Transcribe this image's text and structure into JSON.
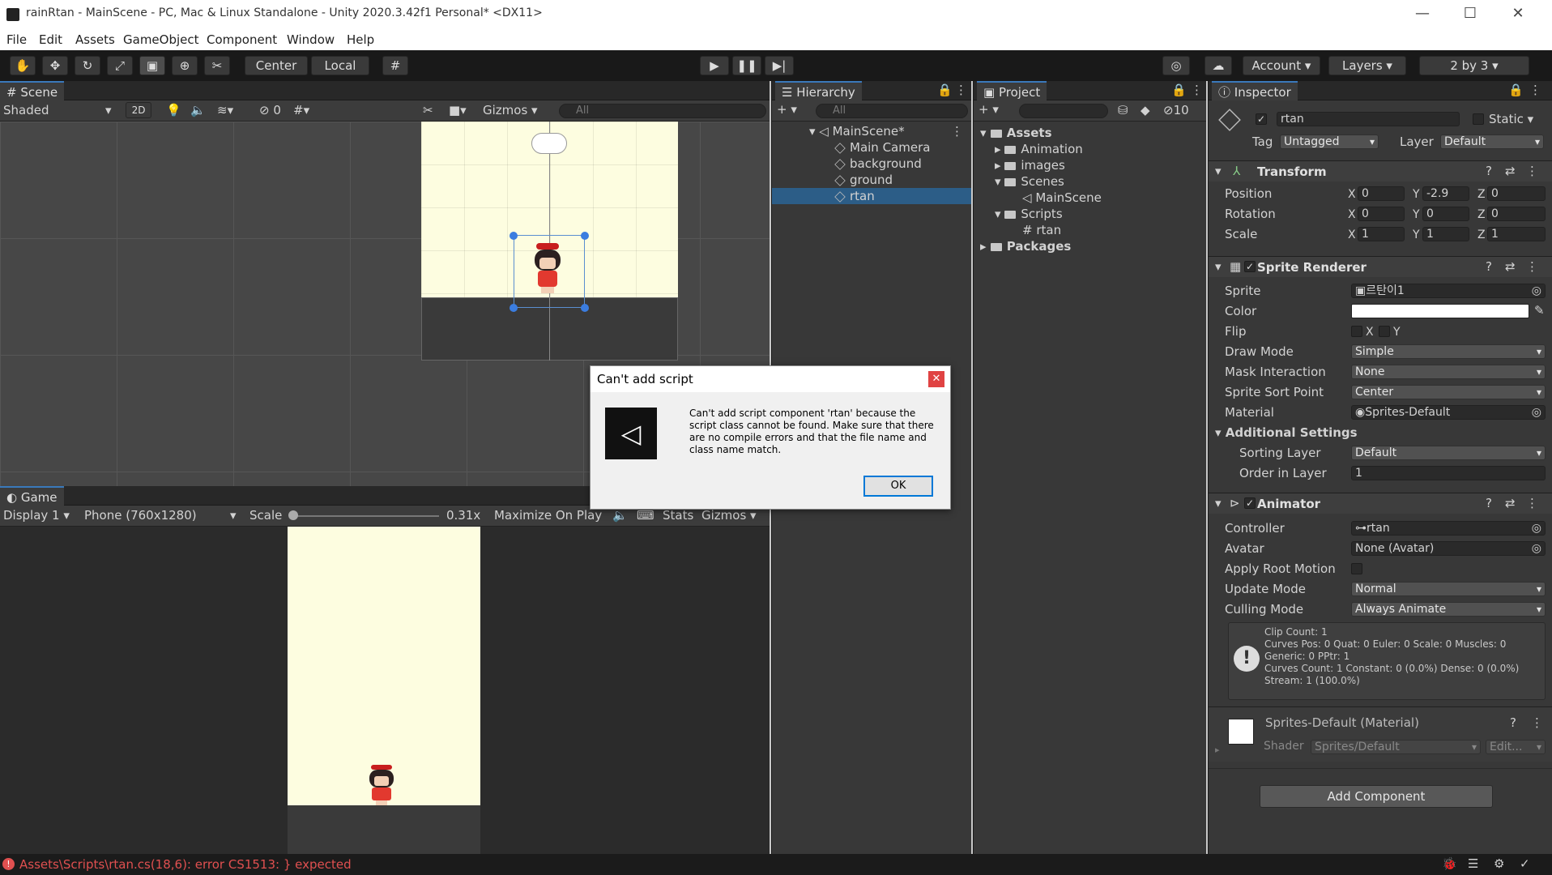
{
  "window": {
    "title": "rainRtan - MainScene - PC, Mac & Linux Standalone - Unity 2020.3.42f1 Personal* <DX11>",
    "minimize": "—",
    "maximize": "☐",
    "close": "✕"
  },
  "menu": [
    "File",
    "Edit",
    "Assets",
    "GameObject",
    "Component",
    "Window",
    "Help"
  ],
  "toolbar": {
    "center": "Center",
    "local": "Local",
    "account": "Account",
    "layers": "Layers",
    "layout": "2 by 3"
  },
  "scene": {
    "tab": "Scene",
    "shading": "Shaded",
    "mode2d": "2D",
    "hidden_count": "0",
    "gizmos": "Gizmos",
    "search": "All"
  },
  "game": {
    "tab": "Game",
    "display": "Display 1",
    "resolution": "Phone (760x1280)",
    "scale_label": "Scale",
    "scale_value": "0.31x",
    "maximize": "Maximize On Play",
    "stats": "Stats",
    "gizmos": "Gizmos"
  },
  "hierarchy": {
    "tab": "Hierarchy",
    "search": "All",
    "scene": "MainScene*",
    "items": [
      "Main Camera",
      "background",
      "ground",
      "rtan"
    ]
  },
  "project": {
    "tab": "Project",
    "count": "10",
    "tree": [
      {
        "label": "Assets"
      },
      {
        "label": "Animation"
      },
      {
        "label": "images"
      },
      {
        "label": "Scenes"
      },
      {
        "label": "MainScene"
      },
      {
        "label": "Scripts"
      },
      {
        "label": "rtan"
      },
      {
        "label": "Packages"
      }
    ]
  },
  "inspector": {
    "tab": "Inspector",
    "name": "rtan",
    "static": "Static",
    "tag_label": "Tag",
    "tag": "Untagged",
    "layer_label": "Layer",
    "layer": "Default",
    "transform": {
      "title": "Transform",
      "position_label": "Position",
      "rotation_label": "Rotation",
      "scale_label": "Scale",
      "pos": [
        "0",
        "-2.9",
        "0"
      ],
      "rot": [
        "0",
        "0",
        "0"
      ],
      "scale": [
        "1",
        "1",
        "1"
      ]
    },
    "sprite_renderer": {
      "title": "Sprite Renderer",
      "sprite_label": "Sprite",
      "sprite": "르탄이1",
      "color_label": "Color",
      "flip_label": "Flip",
      "flip_x": "X",
      "flip_y": "Y",
      "draw_mode_label": "Draw Mode",
      "draw_mode": "Simple",
      "mask_label": "Mask Interaction",
      "mask": "None",
      "sort_point_label": "Sprite Sort Point",
      "sort_point": "Center",
      "material_label": "Material",
      "material": "Sprites-Default",
      "additional": "Additional Settings",
      "sorting_layer_label": "Sorting Layer",
      "sorting_layer": "Default",
      "order_label": "Order in Layer",
      "order": "1"
    },
    "animator": {
      "title": "Animator",
      "controller_label": "Controller",
      "controller": "rtan",
      "avatar_label": "Avatar",
      "avatar": "None (Avatar)",
      "root_motion_label": "Apply Root Motion",
      "update_label": "Update Mode",
      "update": "Normal",
      "culling_label": "Culling Mode",
      "culling": "Always Animate",
      "info": [
        "Clip Count: 1",
        "Curves Pos: 0 Quat: 0 Euler: 0 Scale: 0 Muscles: 0",
        "Generic: 0 PPtr: 1",
        "Curves Count: 1 Constant: 0 (0.0%) Dense: 0 (0.0%)",
        "Stream: 1 (100.0%)"
      ]
    },
    "material": {
      "name": "Sprites-Default (Material)",
      "shader_label": "Shader",
      "shader": "Sprites/Default",
      "edit": "Edit..."
    },
    "add_component": "Add Component"
  },
  "dialog": {
    "title": "Can't add script",
    "message": "Can't add script component 'rtan' because the script class cannot be found. Make sure that there are no compile errors and that the file name and class name match.",
    "ok": "OK"
  },
  "status": {
    "error": "Assets\\Scripts\\rtan.cs(18,6): error CS1513: } expected"
  },
  "colors": {
    "accent": "#3a79bb",
    "scene_bg": "#fdfde0",
    "selection": "#2c5d87",
    "error": "#e05050"
  }
}
